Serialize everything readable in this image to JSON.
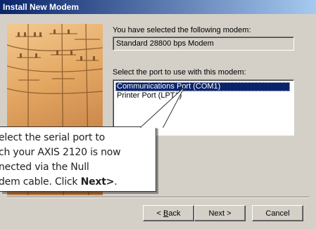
{
  "window": {
    "title": "Install New Modem"
  },
  "main": {
    "selected_label": "You have selected the following modem:",
    "modem_name": "Standard 28800 bps Modem",
    "port_label": "Select the port to use with this modem:",
    "ports": [
      {
        "label": "Communications Port (COM1)",
        "selected": true
      },
      {
        "label": "Printer Port (LPT1)",
        "selected": false
      }
    ]
  },
  "callout": {
    "line1": "elect the serial port to",
    "line2": "ch your AXIS 2120 is now",
    "line3": "nected via the Null",
    "line4_prefix": "dem cable. Click ",
    "line4_bold": "Next>",
    "line4_suffix": "."
  },
  "buttons": {
    "back_prefix": "< ",
    "back_mnemonic": "B",
    "back_rest": "ack",
    "next": "Next >",
    "cancel": "Cancel"
  },
  "colors": {
    "titlebar_start": "#0a246a",
    "titlebar_end": "#a6caf0",
    "dialog_bg": "#d4d0c8",
    "selection_bg": "#0a246a"
  }
}
